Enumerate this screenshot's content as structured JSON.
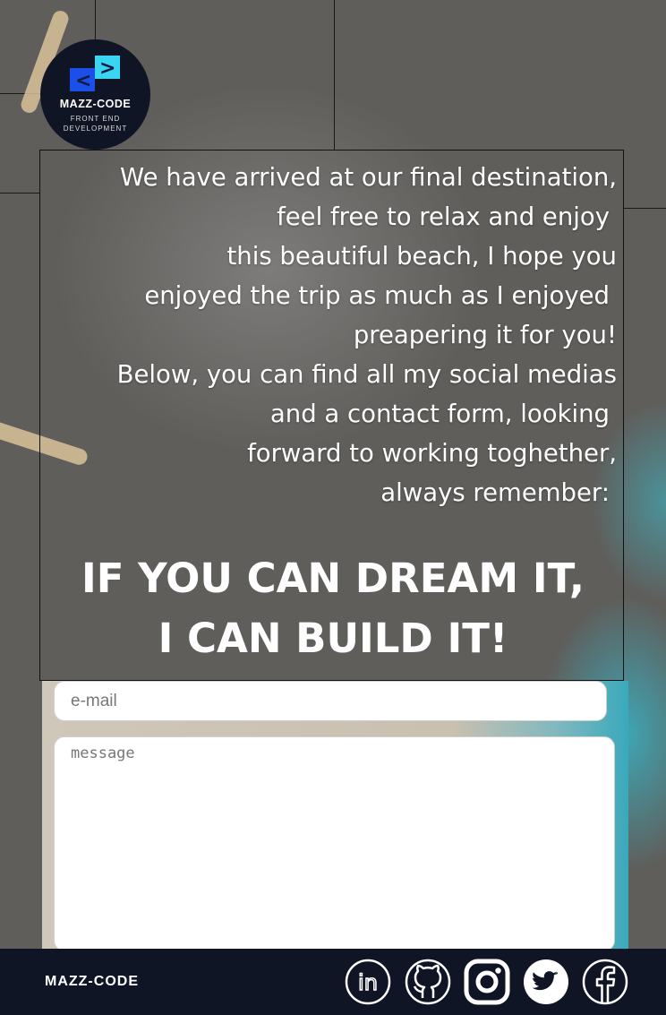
{
  "logo": {
    "name": "MAZZ-CODE",
    "subtitle": "FRONT END DEVELOPMENT",
    "mark_left": "<",
    "mark_right": ">"
  },
  "intro_lines": [
    "We have arrived at our final destination,",
    "feel free to relax and enjoy",
    "this beautiful beach, I hope you",
    "enjoyed the trip as much as I enjoyed",
    "preapering it for you!",
    "Below, you can find all my social medias",
    "and a contact form, looking",
    "forward to working toghether,",
    "always remember:"
  ],
  "motto": [
    "IF YOU CAN DREAM IT,",
    "I CAN BUILD IT!"
  ],
  "form": {
    "email_placeholder": "e-mail",
    "message_placeholder": "message"
  },
  "footer": {
    "brand": "MAZZ-CODE",
    "social_icons": [
      "linkedin-icon",
      "github-icon",
      "instagram-icon",
      "twitter-icon",
      "facebook-icon"
    ],
    "linkedin_glyph": "in"
  }
}
